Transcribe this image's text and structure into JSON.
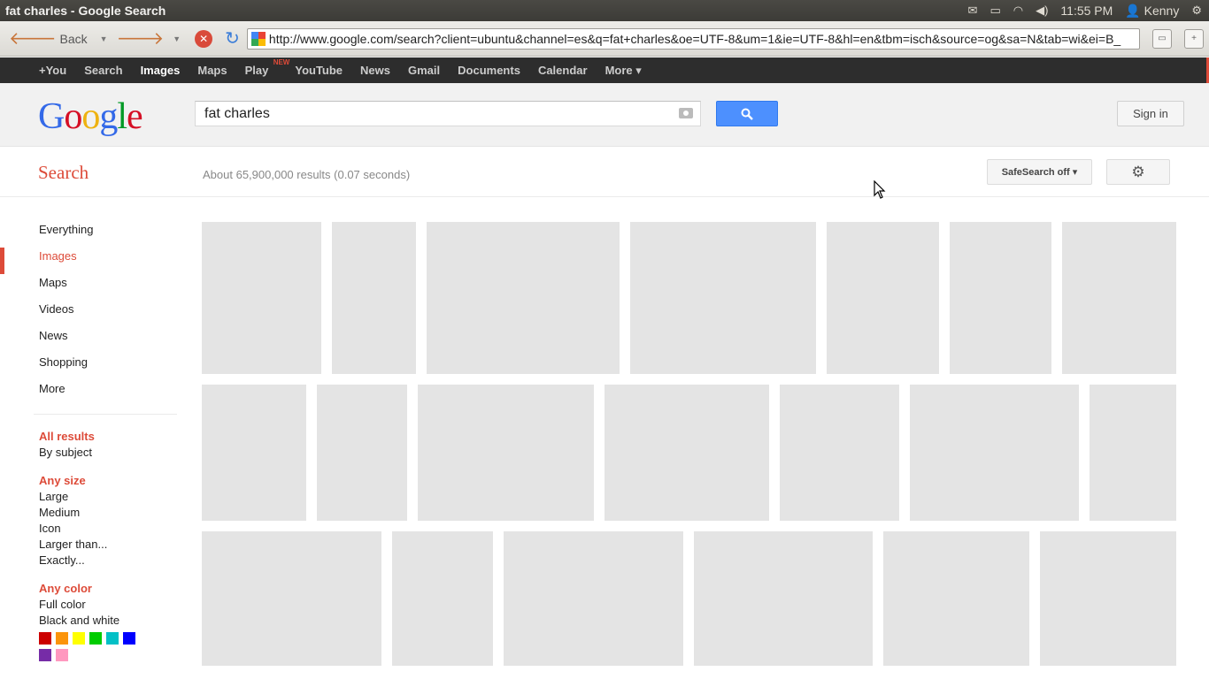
{
  "window": {
    "title": "fat charles - Google Search",
    "tray": {
      "time": "11:55 PM",
      "user": "Kenny"
    }
  },
  "browser": {
    "back_label": "Back",
    "url": "http://www.google.com/search?client=ubuntu&channel=es&q=fat+charles&oe=UTF-8&um=1&ie=UTF-8&hl=en&tbm=isch&source=og&sa=N&tab=wi&ei=B_"
  },
  "gbar": {
    "items": [
      "+You",
      "Search",
      "Images",
      "Maps",
      "Play",
      "YouTube",
      "News",
      "Gmail",
      "Documents",
      "Calendar",
      "More ▾"
    ],
    "play_badge": "NEW"
  },
  "header": {
    "logo": [
      "G",
      "o",
      "o",
      "g",
      "l",
      "e"
    ],
    "query": "fat charles",
    "signin_label": "Sign in"
  },
  "results": {
    "section_label": "Search",
    "stats": "About 65,900,000 results (0.07 seconds)",
    "safesearch_label": "SafeSearch off ▾"
  },
  "leftnav": {
    "items": [
      "Everything",
      "Images",
      "Maps",
      "Videos",
      "News",
      "Shopping",
      "More"
    ],
    "filters": [
      {
        "head": "All results",
        "items": [
          "By subject"
        ]
      },
      {
        "head": "Any size",
        "items": [
          "Large",
          "Medium",
          "Icon",
          "Larger than...",
          "Exactly..."
        ]
      },
      {
        "head": "Any color",
        "items": [
          "Full color",
          "Black and white"
        ]
      }
    ],
    "swatch_colors": [
      "#cc0000",
      "#fb940b",
      "#ffff00",
      "#00cc00",
      "#03c0c6",
      "#0000ff",
      "#762ca7",
      "#ff98bf"
    ]
  },
  "images": {
    "count": 20,
    "content_shown": false
  }
}
